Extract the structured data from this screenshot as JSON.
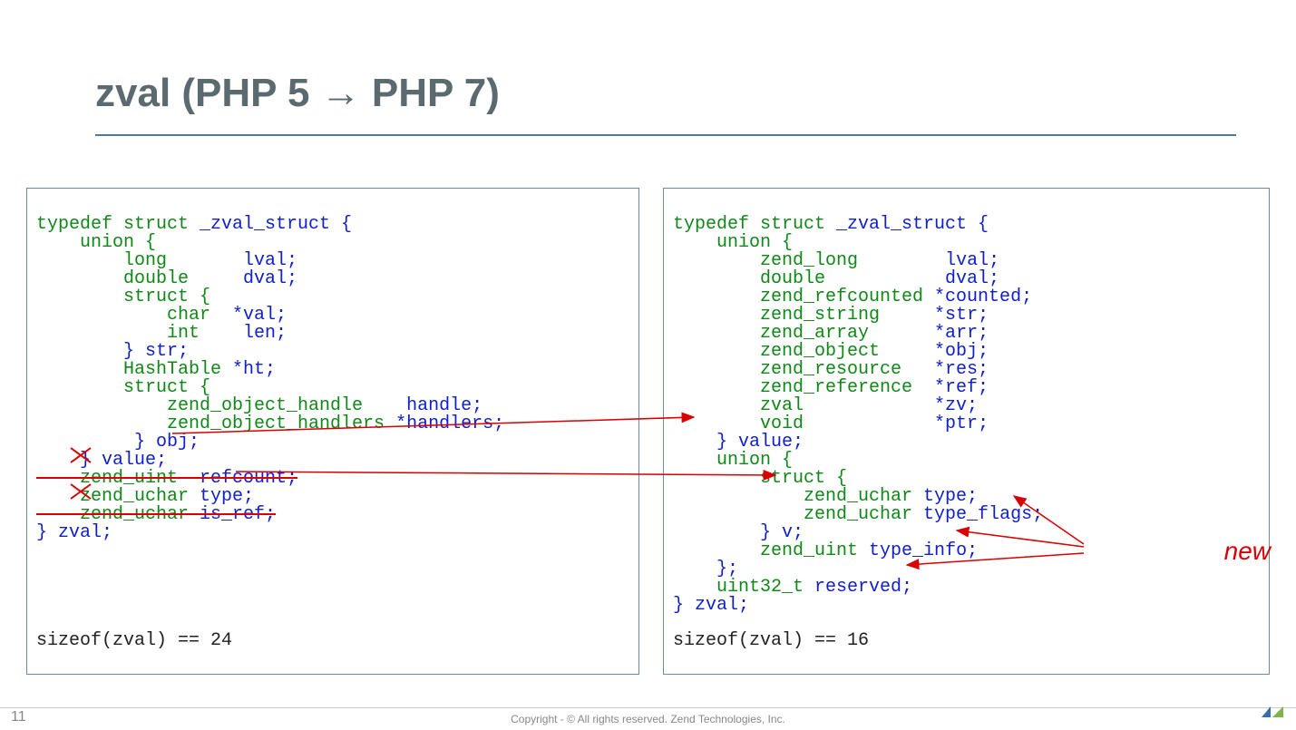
{
  "title": "zval (PHP 5 → PHP 7)",
  "page_number": "11",
  "footer": "Copyright - © All rights reserved. Zend Technologies, Inc.",
  "new_label": "new",
  "left": {
    "sizeof": "sizeof(zval) == 24",
    "l1_a": "typedef",
    "l1_b": " struct",
    "l1_c": " _zval_struct {",
    "l2": "    union {",
    "l3_a": "        long",
    "l3_b": "       lval;",
    "l4_a": "        double",
    "l4_b": "     dval;",
    "l5": "        struct {",
    "l6_a": "            char",
    "l6_b": "  *val;",
    "l7_a": "            int",
    "l7_b": "    len;",
    "l8": "        } str;",
    "l9_a": "        HashTable",
    "l9_b": " *ht;",
    "l10": "        struct {",
    "l11_a": "            zend_object_handle",
    "l11_b": "    handle;",
    "l12_a": "            zend_object_handlers",
    "l12_b": " *handlers;",
    "l13": "         } obj;",
    "l14": "    } value;",
    "l15_a": "    zend_uint",
    "l15_b": "  refcount;",
    "l16_a": "    zend_uchar",
    "l16_b": " type;",
    "l17_a": "    zend_uchar",
    "l17_b": " is_ref;",
    "l18": "} zval;"
  },
  "right": {
    "sizeof": "sizeof(zval) == 16",
    "l1_a": "typedef",
    "l1_b": " struct",
    "l1_c": " _zval_struct {",
    "l2": "    union {",
    "l3_a": "        zend_long",
    "l3_b": "        lval;",
    "l4_a": "        double",
    "l4_b": "           dval;",
    "l5_a": "        zend_refcounted",
    "l5_b": " *counted;",
    "l6_a": "        zend_string",
    "l6_b": "     *str;",
    "l7_a": "        zend_array",
    "l7_b": "      *arr;",
    "l8_a": "        zend_object",
    "l8_b": "     *obj;",
    "l9_a": "        zend_resource",
    "l9_b": "   *res;",
    "l10_a": "        zend_reference",
    "l10_b": "  *ref;",
    "l11_a": "        zval",
    "l11_b": "            *zv;",
    "l12_a": "        void",
    "l12_b": "            *ptr;",
    "l13": "    } value;",
    "l14": "    union {",
    "l15": "        struct {",
    "l16_a": "            zend_uchar",
    "l16_b": " type;",
    "l17_a": "            zend_uchar",
    "l17_b": " type_flags;",
    "l18": "        } v;",
    "l19_a": "        zend_uint",
    "l19_b": " type_info;",
    "l20": "    };",
    "l21_a": "    uint32_t",
    "l21_b": " reserved;",
    "l22": "} zval;"
  }
}
